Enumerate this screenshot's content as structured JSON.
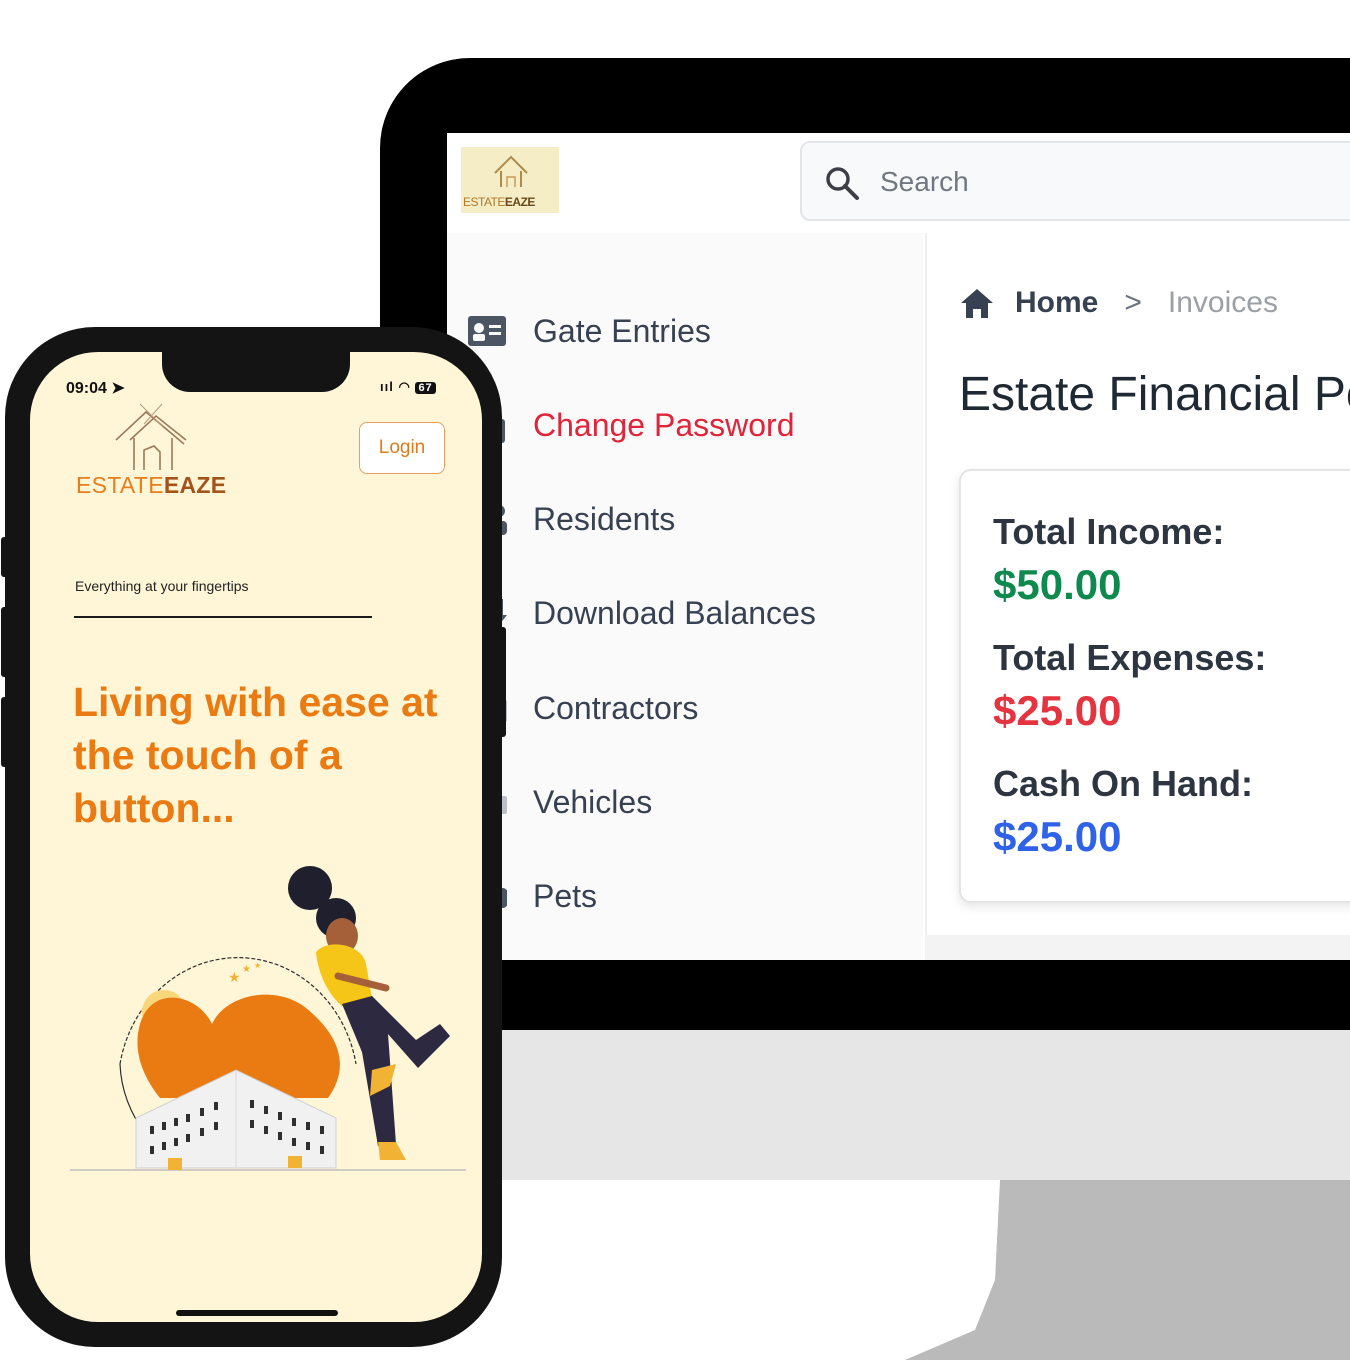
{
  "desktop": {
    "logo": {
      "text_light": "ESTATE",
      "text_bold": "EAZE"
    },
    "search": {
      "placeholder": "Search"
    },
    "sidebar": {
      "items": [
        {
          "label": "Gate Entries",
          "icon": "id-card-icon"
        },
        {
          "label": "Change Password",
          "icon": "lock-icon",
          "active": true
        },
        {
          "label": "Residents",
          "icon": "user-icon"
        },
        {
          "label": "Download Balances",
          "icon": "download-icon"
        },
        {
          "label": "Contractors",
          "icon": "briefcase-icon"
        },
        {
          "label": "Vehicles",
          "icon": "car-icon"
        },
        {
          "label": "Pets",
          "icon": "paw-icon"
        }
      ]
    },
    "breadcrumb": {
      "home": "Home",
      "separator": ">",
      "current": "Invoices"
    },
    "page_title": "Estate Financial Po",
    "summary": {
      "income_label": "Total Income:",
      "income_value": "$50.00",
      "expenses_label": "Total Expenses:",
      "expenses_value": "$25.00",
      "cash_label": "Cash On Hand:",
      "cash_value": "$25.00"
    }
  },
  "phone": {
    "status": {
      "time": "09:04",
      "signal": "ııl",
      "battery": "67"
    },
    "logo": {
      "text_light": "ESTATE",
      "text_bold": "EAZE"
    },
    "login_label": "Login",
    "tagline": "Everything at your fingertips",
    "headline": "Living with ease at the touch of a button..."
  },
  "colors": {
    "accent_orange": "#ea7a12",
    "active_red": "#e0243a",
    "income_green": "#0f8a4e",
    "expense_red": "#e3343f",
    "cash_blue": "#2f62e6",
    "phone_background": "#fff6d8"
  }
}
